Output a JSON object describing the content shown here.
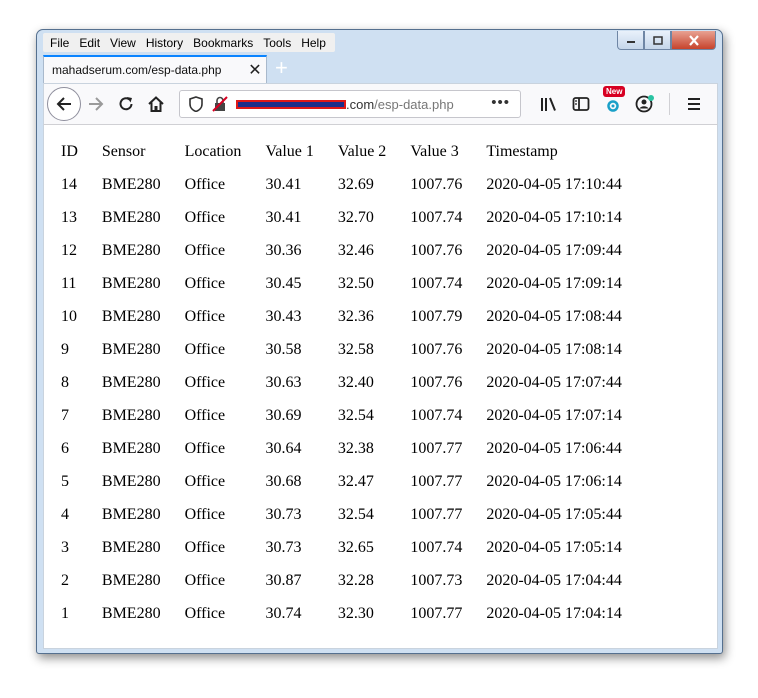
{
  "menu": [
    "File",
    "Edit",
    "View",
    "History",
    "Bookmarks",
    "Tools",
    "Help"
  ],
  "tab": {
    "title": "mahadserum.com/esp-data.php",
    "close": "✕",
    "new_tab": "+"
  },
  "url": {
    "domain_suffix": ".com",
    "path": "/esp-data.php",
    "actions": "•••"
  },
  "toolbar": {
    "new_badge": "New"
  },
  "table": {
    "headers": [
      "ID",
      "Sensor",
      "Location",
      "Value 1",
      "Value 2",
      "Value 3",
      "Timestamp"
    ],
    "rows": [
      [
        "14",
        "BME280",
        "Office",
        "30.41",
        "32.69",
        "1007.76",
        "2020-04-05 17:10:44"
      ],
      [
        "13",
        "BME280",
        "Office",
        "30.41",
        "32.70",
        "1007.74",
        "2020-04-05 17:10:14"
      ],
      [
        "12",
        "BME280",
        "Office",
        "30.36",
        "32.46",
        "1007.76",
        "2020-04-05 17:09:44"
      ],
      [
        "11",
        "BME280",
        "Office",
        "30.45",
        "32.50",
        "1007.74",
        "2020-04-05 17:09:14"
      ],
      [
        "10",
        "BME280",
        "Office",
        "30.43",
        "32.36",
        "1007.79",
        "2020-04-05 17:08:44"
      ],
      [
        "9",
        "BME280",
        "Office",
        "30.58",
        "32.58",
        "1007.76",
        "2020-04-05 17:08:14"
      ],
      [
        "8",
        "BME280",
        "Office",
        "30.63",
        "32.40",
        "1007.76",
        "2020-04-05 17:07:44"
      ],
      [
        "7",
        "BME280",
        "Office",
        "30.69",
        "32.54",
        "1007.74",
        "2020-04-05 17:07:14"
      ],
      [
        "6",
        "BME280",
        "Office",
        "30.64",
        "32.38",
        "1007.77",
        "2020-04-05 17:06:44"
      ],
      [
        "5",
        "BME280",
        "Office",
        "30.68",
        "32.47",
        "1007.77",
        "2020-04-05 17:06:14"
      ],
      [
        "4",
        "BME280",
        "Office",
        "30.73",
        "32.54",
        "1007.77",
        "2020-04-05 17:05:44"
      ],
      [
        "3",
        "BME280",
        "Office",
        "30.73",
        "32.65",
        "1007.74",
        "2020-04-05 17:05:14"
      ],
      [
        "2",
        "BME280",
        "Office",
        "30.87",
        "32.28",
        "1007.73",
        "2020-04-05 17:04:44"
      ],
      [
        "1",
        "BME280",
        "Office",
        "30.74",
        "32.30",
        "1007.77",
        "2020-04-05 17:04:14"
      ]
    ]
  }
}
